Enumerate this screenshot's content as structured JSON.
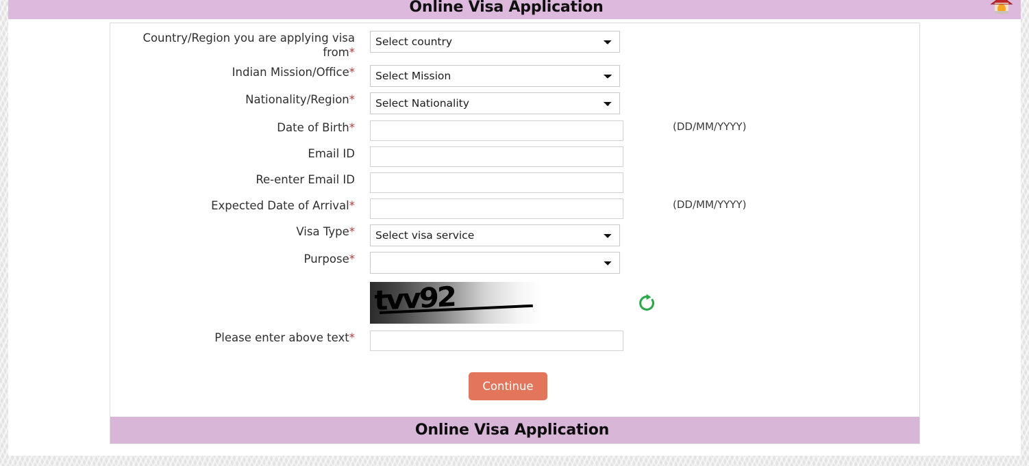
{
  "header": {
    "title": "Online Visa Application",
    "home_icon": "home-icon"
  },
  "footer": {
    "title": "Online Visa Application"
  },
  "form": {
    "rows": [
      {
        "label": "Country/Region you are applying visa from",
        "required": "*",
        "control": "select",
        "value": "Select country",
        "hint": ""
      },
      {
        "label": "Indian Mission/Office",
        "required": "*",
        "control": "select",
        "value": "Select Mission",
        "hint": ""
      },
      {
        "label": "Nationality/Region",
        "required": "*",
        "control": "select",
        "value": "Select Nationality",
        "hint": ""
      },
      {
        "label": "Date of Birth",
        "required": "*",
        "control": "input",
        "value": "",
        "placeholder": "",
        "hint": "(DD/MM/YYYY)"
      },
      {
        "label": "Email ID",
        "required": "",
        "control": "input",
        "value": "",
        "placeholder": "",
        "hint": ""
      },
      {
        "label": "Re-enter Email ID",
        "required": "",
        "control": "input",
        "value": "",
        "placeholder": "",
        "hint": ""
      },
      {
        "label": "Expected Date of Arrival",
        "required": "*",
        "control": "input",
        "value": "",
        "placeholder": "",
        "hint": "(DD/MM/YYYY)"
      },
      {
        "label": "Visa Type",
        "required": "*",
        "control": "select",
        "value": "Select visa service",
        "hint": ""
      },
      {
        "label": "Purpose",
        "required": "*",
        "control": "select",
        "value": "",
        "hint": ""
      }
    ],
    "captcha": {
      "text": "tvv92",
      "refresh_icon": "refresh-icon"
    },
    "captcha_field": {
      "label": "Please enter above text",
      "required": "*",
      "value": "",
      "placeholder": ""
    },
    "submit": {
      "label": "Continue"
    }
  },
  "colors": {
    "banner": "#ddb9dd",
    "banner_bottom": "#d8b6d8",
    "submit_button": "#e3765a",
    "required_asterisk": "#b33a3a",
    "refresh_icon": "#2aa84a",
    "home_roof": "#c0272d"
  }
}
